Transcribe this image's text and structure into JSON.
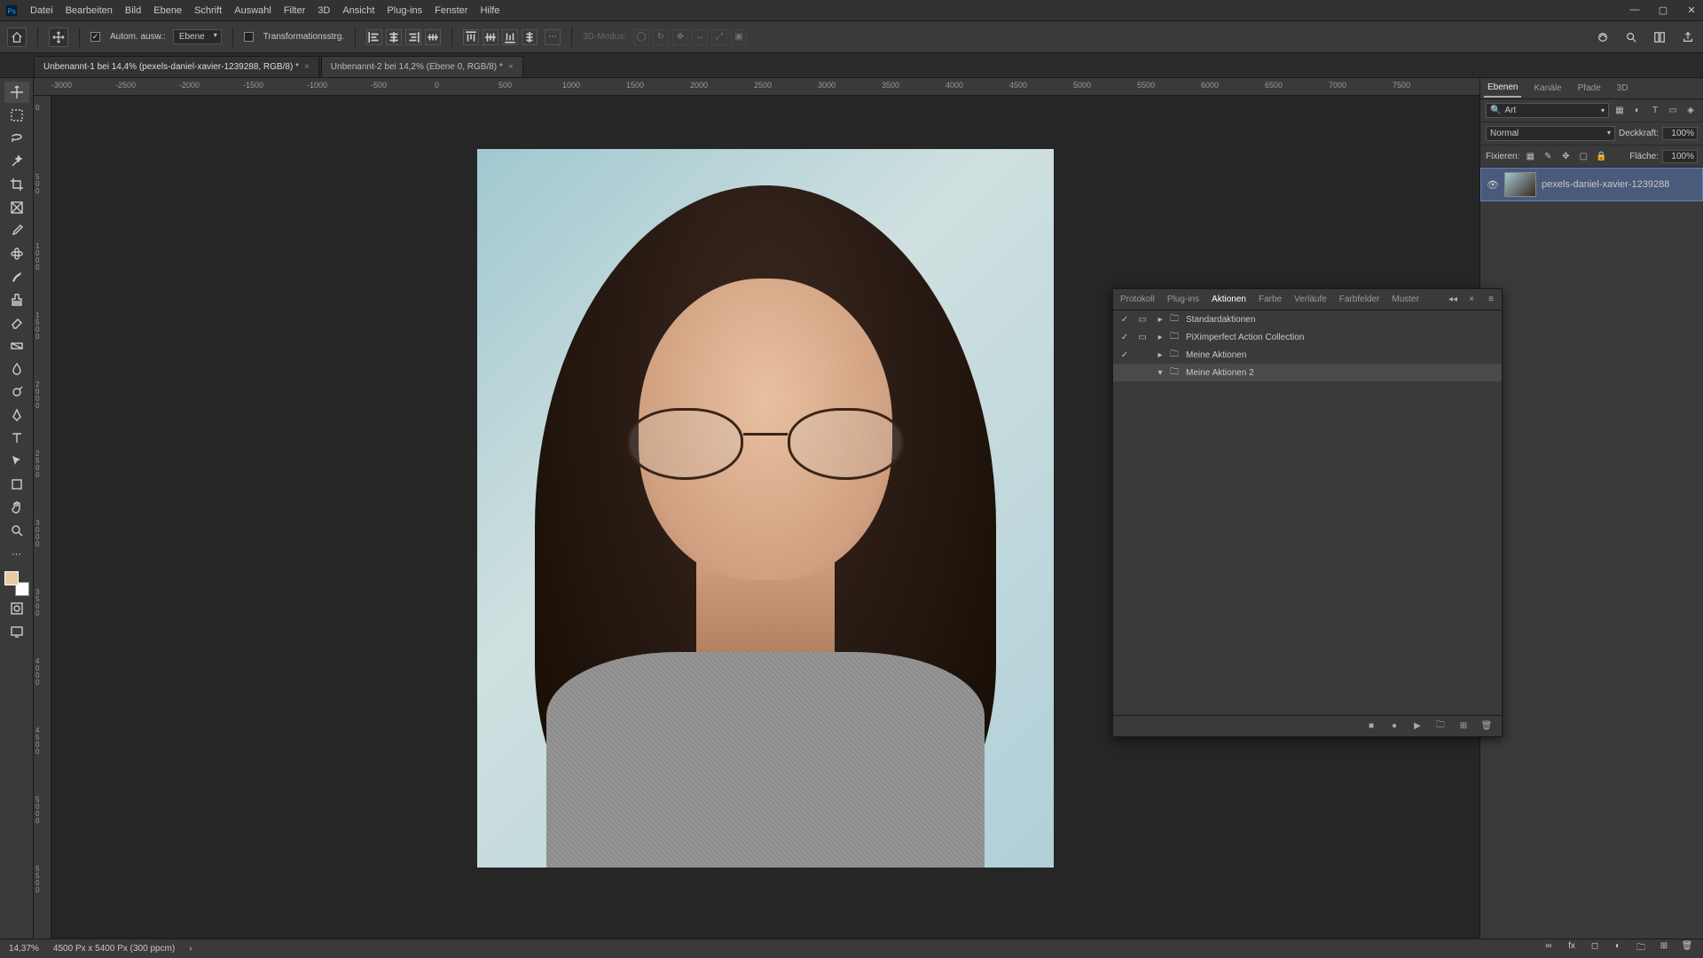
{
  "menu": {
    "items": [
      "Datei",
      "Bearbeiten",
      "Bild",
      "Ebene",
      "Schrift",
      "Auswahl",
      "Filter",
      "3D",
      "Ansicht",
      "Plug-ins",
      "Fenster",
      "Hilfe"
    ]
  },
  "optbar": {
    "auto_select": "Autom. ausw.:",
    "layer_dd": "Ebene",
    "transform": "Transformationsstrg.",
    "mode3d": "3D-Modus:"
  },
  "tabs": [
    {
      "title": "Unbenannt-1 bei 14,4% (pexels-daniel-xavier-1239288, RGB/8) *"
    },
    {
      "title": "Unbenannt-2 bei 14,2% (Ebene 0, RGB/8) *"
    }
  ],
  "ruler_h": [
    "-3000",
    "-2500",
    "-2000",
    "-1500",
    "-1000",
    "-500",
    "0",
    "500",
    "1000",
    "1500",
    "2000",
    "2500",
    "3000",
    "3500",
    "4000",
    "4500",
    "5000",
    "5500",
    "6000",
    "6500",
    "7000",
    "7500"
  ],
  "ruler_v": [
    "0",
    "500",
    "1000",
    "1500",
    "2000",
    "2500",
    "3000",
    "3500",
    "4000",
    "4500",
    "5000",
    "5500"
  ],
  "layers_panel": {
    "tabs": [
      "Ebenen",
      "Kanäle",
      "Pfade",
      "3D"
    ],
    "search_label": "Art",
    "blend": "Normal",
    "opacity_label": "Deckkraft:",
    "opacity_val": "100%",
    "lock_label": "Fixieren:",
    "fill_label": "Fläche:",
    "fill_val": "100%",
    "layer_name": "pexels-daniel-xavier-1239288"
  },
  "actions_panel": {
    "tabs": [
      "Protokoll",
      "Plug-ins",
      "Aktionen",
      "Farbe",
      "Verläufe",
      "Farbfelder",
      "Muster"
    ],
    "rows": [
      {
        "checked": true,
        "dialog": true,
        "expand": true,
        "name": "Standardaktionen"
      },
      {
        "checked": true,
        "dialog": true,
        "expand": true,
        "name": "PiXimperfect Action Collection"
      },
      {
        "checked": true,
        "dialog": false,
        "expand": true,
        "name": "Meine Aktionen"
      },
      {
        "checked": false,
        "dialog": false,
        "expand": false,
        "name": "Meine Aktionen 2",
        "selected": true
      }
    ]
  },
  "status": {
    "zoom": "14,37%",
    "docinfo": "4500 Px x 5400 Px (300 ppcm)"
  }
}
